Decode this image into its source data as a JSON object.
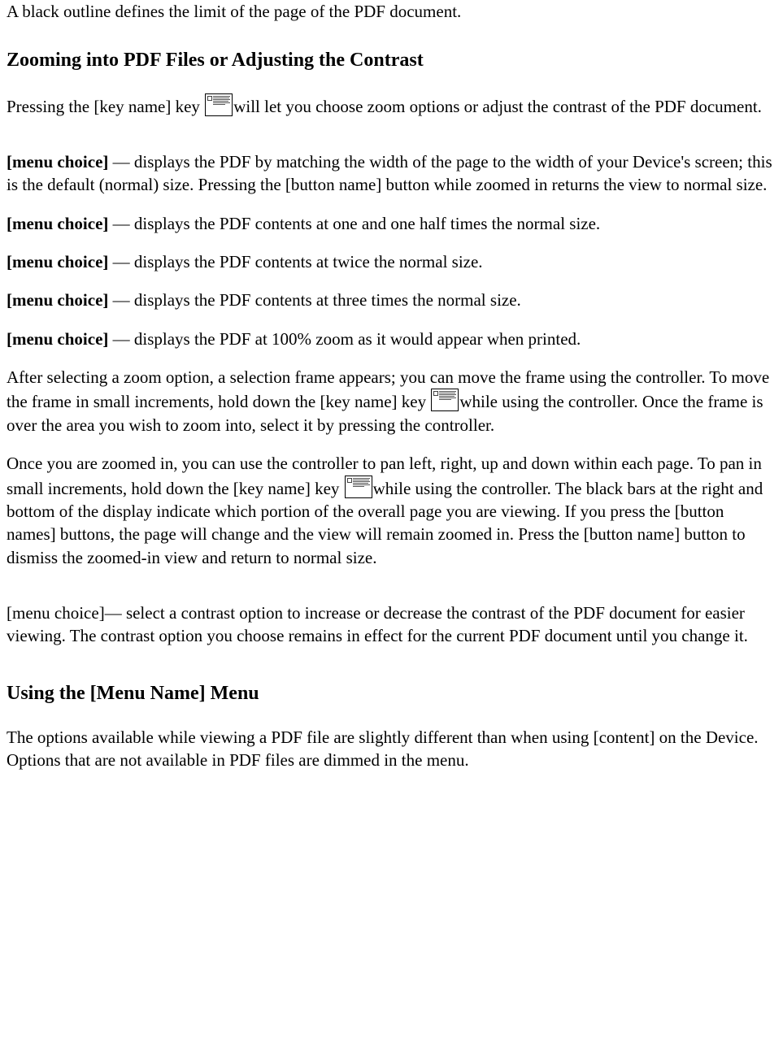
{
  "intro_outline": "A black outline defines the limit of the page of the PDF document.",
  "heading_zoom": "Zooming into PDF Files or Adjusting the Contrast",
  "zoom_intro_p1": "Pressing the [key name] key ",
  "zoom_intro_p2": "will let you choose zoom options or adjust the contrast of the PDF document.",
  "mc_label": "[menu choice]",
  "mc1_rest": " — displays the PDF by matching the width of the page to the width of your Device's screen; this is the default (normal) size. Pressing the [button name] button while zoomed in returns the view to normal size.",
  "mc2_rest": " — displays the PDF contents at one and one half times the normal size.",
  "mc3_rest": " — displays the PDF contents at twice the normal size.",
  "mc4_rest": " — displays the PDF contents at three times the normal size.",
  "mc5_rest": " — displays the PDF at 100% zoom as it would appear when printed.",
  "after_select_p1": "After selecting a zoom option, a selection frame appears; you can move the frame using the controller. To move the frame in small increments, hold down the [key name] key ",
  "after_select_p2": "while using the controller. Once the frame is over the area you wish to zoom into, select it by pressing the controller.",
  "once_zoomed_p1": "Once you are zoomed in, you can use the controller to pan left, right, up and down within each page. To pan in small increments, hold down the [key name] key ",
  "once_zoomed_p2": "while using the controller. The black bars at the right and bottom of the display indicate which portion of the overall page you are viewing. If you press the [button names] buttons, the page will change and the view will remain zoomed in. Press the [button name] button to dismiss the zoomed-in view and return to normal size.",
  "contrast_text": "[menu choice]— select a contrast option to increase or decrease the contrast of the PDF document for easier viewing. The contrast option you choose remains in effect for the current PDF document until you change it.",
  "heading_menu": "Using the [Menu Name] Menu",
  "menu_para": "The options available while viewing a PDF file are slightly different than when using [content] on the Device. Options that are not available in PDF files are dimmed in the menu."
}
